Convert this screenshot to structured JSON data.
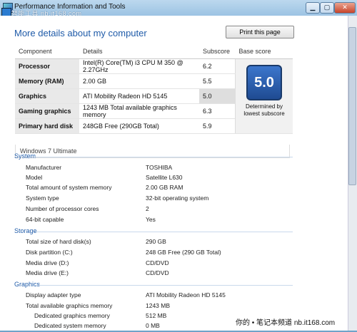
{
  "window": {
    "title": "Performance Information and Tools"
  },
  "watermark_top": "智能工具 nb.it168.com",
  "watermark_bottom": "你的 • 笔记本频道 nb.it168.com",
  "heading": "More details about my computer",
  "print_button": "Print this page",
  "perf_table": {
    "headers": [
      "Component",
      "Details",
      "Subscore",
      "Base score"
    ],
    "rows": [
      {
        "component": "Processor",
        "details": "Intel(R) Core(TM) i3 CPU M 350 @ 2.27GHz",
        "subscore": "6.2"
      },
      {
        "component": "Memory (RAM)",
        "details": "2.00 GB",
        "subscore": "5.5"
      },
      {
        "component": "Graphics",
        "details": "ATI Mobility Radeon HD 5145",
        "subscore": "5.0"
      },
      {
        "component": "Gaming graphics",
        "details": "1243 MB Total available graphics memory",
        "subscore": "6.3"
      },
      {
        "component": "Primary hard disk",
        "details": "248GB Free (290GB Total)",
        "subscore": "5.9"
      }
    ],
    "base_score": "5.0",
    "base_caption_1": "Determined by",
    "base_caption_2": "lowest subscore"
  },
  "os_name": "Windows 7 Ultimate",
  "system": {
    "title": "System",
    "rows": [
      {
        "label": "Manufacturer",
        "value": "TOSHIBA"
      },
      {
        "label": "Model",
        "value": "Satellite L630"
      },
      {
        "label": "Total amount of system memory",
        "value": "2.00 GB RAM"
      },
      {
        "label": "System type",
        "value": "32-bit operating system"
      },
      {
        "label": "Number of processor cores",
        "value": "2"
      },
      {
        "label": "64-bit capable",
        "value": "Yes"
      }
    ]
  },
  "storage": {
    "title": "Storage",
    "rows": [
      {
        "label": "Total size of hard disk(s)",
        "value": "290 GB"
      },
      {
        "label": "Disk partition (C:)",
        "value": "248 GB Free (290 GB Total)"
      },
      {
        "label": "Media drive (D:)",
        "value": "CD/DVD"
      },
      {
        "label": "Media drive (E:)",
        "value": "CD/DVD"
      }
    ]
  },
  "graphics": {
    "title": "Graphics",
    "rows": [
      {
        "label": "Display adapter type",
        "value": "ATI Mobility Radeon HD 5145"
      },
      {
        "label": "Total available graphics memory",
        "value": "1243 MB"
      },
      {
        "label": "Dedicated graphics memory",
        "value": "512 MB"
      },
      {
        "label": "Dedicated system memory",
        "value": "0 MB"
      }
    ]
  }
}
